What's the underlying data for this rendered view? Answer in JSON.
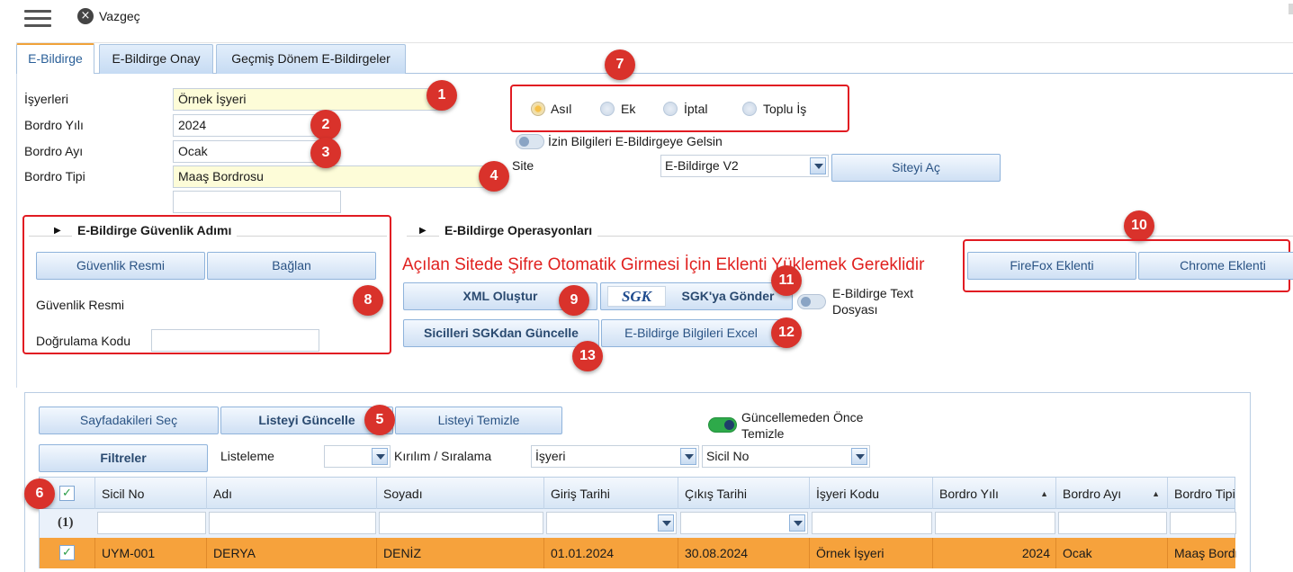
{
  "topbar": {
    "cancel_label": "Vazgeç"
  },
  "tabs": [
    {
      "label": "E-Bildirge"
    },
    {
      "label": "E-Bildirge Onay"
    },
    {
      "label": "Geçmiş Dönem E-Bildirgeler"
    }
  ],
  "form": {
    "isyerleri_label": "İşyerleri",
    "isyerleri_value": "Örnek İşyeri",
    "bordro_yili_label": "Bordro Yılı",
    "bordro_yili_value": "2024",
    "bordro_ayi_label": "Bordro Ayı",
    "bordro_ayi_value": "Ocak",
    "bordro_tipi_label": "Bordro Tipi",
    "bordro_tipi_value": "Maaş Bordrosu",
    "extra_value": ""
  },
  "radios": [
    {
      "label": "Asıl",
      "selected": true
    },
    {
      "label": "Ek",
      "selected": false
    },
    {
      "label": "İptal",
      "selected": false
    },
    {
      "label": "Toplu İş",
      "selected": false
    }
  ],
  "izin": {
    "label": "İzin Bilgileri E-Bildirgeye Gelsin",
    "on": false
  },
  "site": {
    "label": "Site",
    "value": "E-Bildirge V2",
    "open_button": "Siteyi Aç"
  },
  "security": {
    "title": "E-Bildirge Güvenlik Adımı",
    "image_button": "Güvenlik Resmi",
    "connect_button": "Bağlan",
    "image_label": "Güvenlik Resmi",
    "code_label": "Doğrulama Kodu",
    "code_value": ""
  },
  "operations": {
    "title": "E-Bildirge Operasyonları",
    "notice": "Açılan Sitede Şifre Otomatik Girmesi İçin Eklenti Yüklemek Gereklidir",
    "xml_button": "XML Oluştur",
    "sgk_logo": "SGK",
    "sgk_button": "SGK'ya Gönder",
    "text_file_label_1": "E-Bildirge Text",
    "text_file_label_2": "Dosyası",
    "sicil_button": "Sicilleri SGKdan Güncelle",
    "excel_button": "E-Bildirge Bilgileri Excel"
  },
  "extensions": {
    "firefox": "FireFox Eklenti",
    "chrome": "Chrome Eklenti"
  },
  "list": {
    "select_page_button": "Sayfadakileri Seç",
    "update_button": "Listeyi Güncelle",
    "clear_button": "Listeyi Temizle",
    "clear_before_label_1": "Güncellemeden Önce",
    "clear_before_label_2": "Temizle",
    "filters_button": "Filtreler",
    "listing_label": "Listeleme",
    "listing_value": "",
    "break_label": "Kırılım / Sıralama",
    "break_value_1": "İşyeri",
    "break_value_2": "Sicil No"
  },
  "grid": {
    "columns": [
      "Sicil No",
      "Adı",
      "Soyadı",
      "Giriş Tarihi",
      "Çıkış Tarihi",
      "İşyeri Kodu",
      "Bordro Yılı",
      "Bordro Ayı",
      "Bordro Tipi"
    ],
    "group_count": "(1)",
    "rows": [
      {
        "sicil_no": "UYM-001",
        "adi": "DERYA",
        "soyadi": "DENİZ",
        "giris": "01.01.2024",
        "cikis": "30.08.2024",
        "isyeri": "Örnek İşyeri",
        "yil": "2024",
        "ay": "Ocak",
        "tip": "Maaş Bordrosu"
      }
    ]
  },
  "badges": [
    "1",
    "2",
    "3",
    "4",
    "5",
    "6",
    "7",
    "8",
    "9",
    "10",
    "11",
    "12",
    "13"
  ],
  "colors": {
    "accent_red": "#e11b22",
    "row_highlight": "#f6a23c",
    "tab_active": "#f0a23a"
  }
}
